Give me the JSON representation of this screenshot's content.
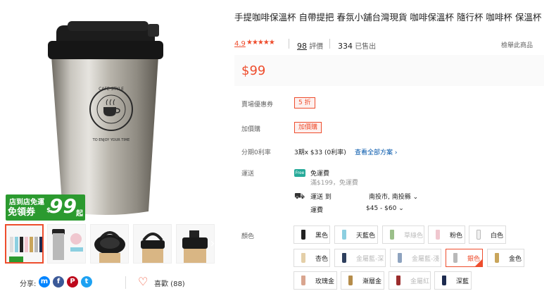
{
  "product": {
    "title": "手提咖啡保溫杯 自帶提把 春氛小舖台灣現貨 咖啡保溫杯 隨行杯 咖啡杯 保溫杯",
    "rating": "4.9",
    "rating_value": 5,
    "reviews_count": "98",
    "reviews_label": "評價",
    "sold_count": "334",
    "sold_label": "已售出",
    "report_label": "檢舉此商品",
    "price": "$99"
  },
  "cup_logo_text": "CAFE STYLE",
  "cup_slogan": "TO ENJOY YOUR TIME",
  "promo": {
    "line1": "店到店免運",
    "line2": "免領券",
    "currency": "$",
    "amount": "99",
    "suffix": "起"
  },
  "gallery": {
    "thumbs": [
      "thumb-1",
      "thumb-2",
      "thumb-3",
      "thumb-4",
      "thumb-5"
    ],
    "next_icon": "›"
  },
  "share": {
    "label": "分享:",
    "icons": [
      {
        "name": "messenger-icon",
        "glyph": "m",
        "color": "#0084ff"
      },
      {
        "name": "facebook-icon",
        "glyph": "f",
        "color": "#3b5998"
      },
      {
        "name": "pinterest-icon",
        "glyph": "P",
        "color": "#bd081c"
      },
      {
        "name": "twitter-icon",
        "glyph": "t",
        "color": "#1da1f2"
      }
    ]
  },
  "like": {
    "label": "喜歡 (88)"
  },
  "info": {
    "voucher_label": "賣場優惠券",
    "voucher_tag": "5 折",
    "addon_label": "加價購",
    "addon_tag": "加價購",
    "installment_label": "分期0利率",
    "installment_text": "3期x $33 (0利率)",
    "installment_link": "查看全部方案",
    "shipping_label": "運送",
    "free_shipping": "免運費",
    "free_shipping_sub": "滿$199，免運費",
    "ship_to_label": "運送 到",
    "ship_to_value": "南投市, 南投縣",
    "fee_label": "運費",
    "fee_value": "$45 - $60",
    "free_badge": "Free",
    "color_label": "顏色"
  },
  "colors": [
    {
      "name": "黑色",
      "swatch": "#222222",
      "state": "normal"
    },
    {
      "name": "天藍色",
      "swatch": "#8ccfe0",
      "state": "normal"
    },
    {
      "name": "草綠色",
      "swatch": "#9bbf8a",
      "state": "disabled"
    },
    {
      "name": "粉色",
      "swatch": "#f0c7cf",
      "state": "normal"
    },
    {
      "name": "白色",
      "swatch": "#f0f0f0",
      "state": "normal"
    },
    {
      "name": "杏色",
      "swatch": "#e4cfa8",
      "state": "normal"
    },
    {
      "name": "金屬藍-深",
      "swatch": "#2e3f5e",
      "state": "disabled"
    },
    {
      "name": "金屬藍-淺",
      "swatch": "#8ea3bf",
      "state": "disabled"
    },
    {
      "name": "銀色",
      "swatch": "#b9b9b9",
      "state": "selected"
    },
    {
      "name": "金色",
      "swatch": "#c9a55b",
      "state": "normal"
    },
    {
      "name": "玫瑰金",
      "swatch": "#d9a58f",
      "state": "normal"
    },
    {
      "name": "漸層金",
      "swatch": "#b58c4a",
      "state": "normal"
    },
    {
      "name": "金屬紅",
      "swatch": "#9b2d2d",
      "state": "disabled"
    },
    {
      "name": "深藍",
      "swatch": "#1d2b4f",
      "state": "normal"
    }
  ]
}
